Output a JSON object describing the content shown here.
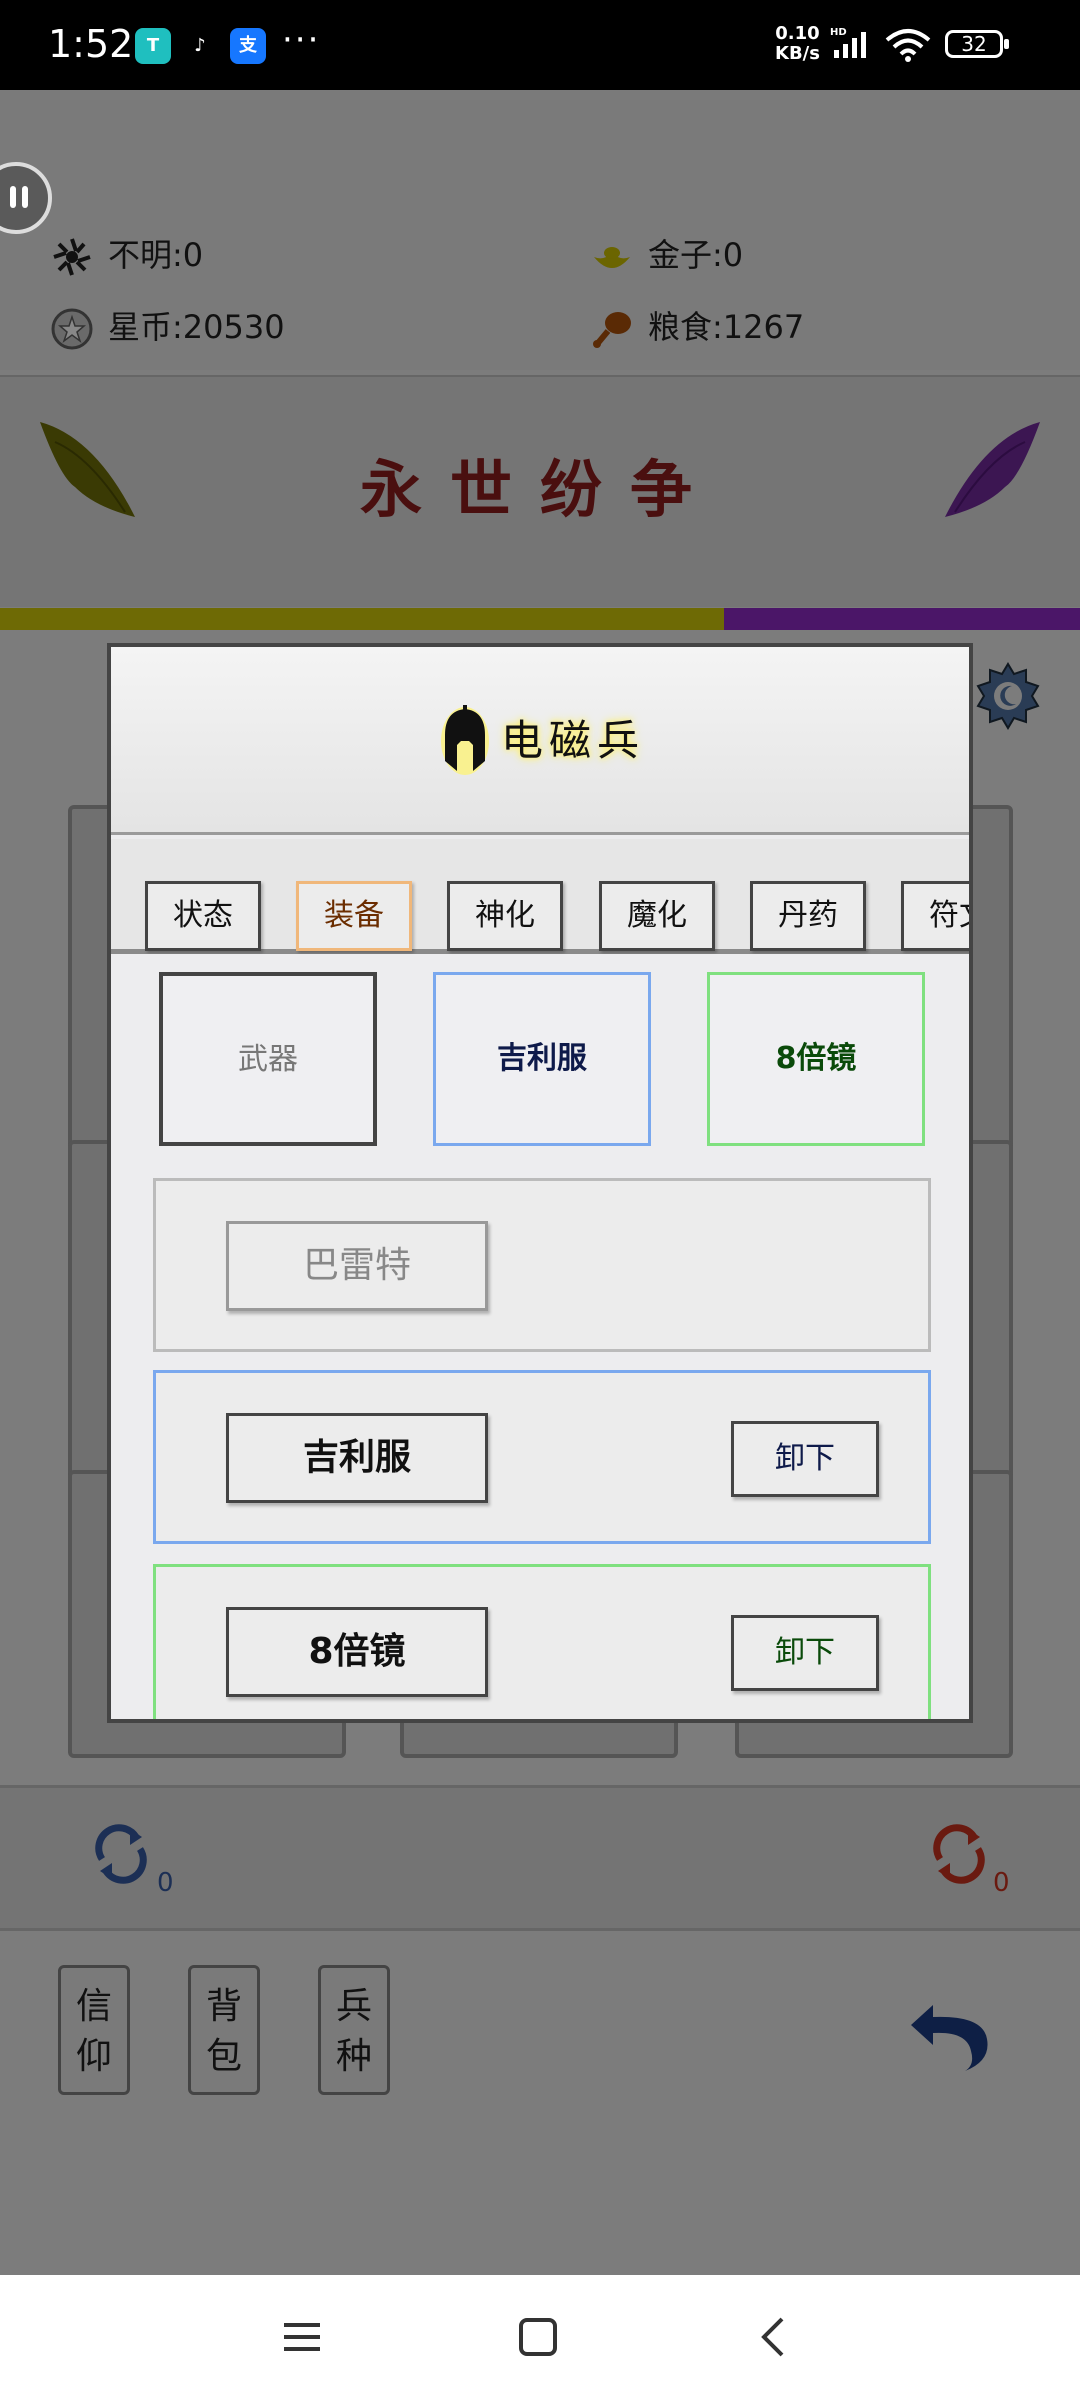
{
  "status_bar": {
    "time": "1:52",
    "app_icons": [
      "TapTap",
      "TikTok",
      "Alipay"
    ],
    "more": "···",
    "net_speed_value": "0.10",
    "net_speed_unit": "KB/s",
    "network": "HD",
    "battery": "32"
  },
  "resources": {
    "unknown_label": "不明:0",
    "gold_label": "金子:0",
    "starcoin_label": "星币:20530",
    "food_label": "粮食:1267"
  },
  "game": {
    "title": "永世纷争",
    "progress_fraction": 0.67,
    "refresh_left_count": "0",
    "refresh_right_count": "0",
    "side_buttons": [
      "信\n仰",
      "背\n包",
      "兵\n种"
    ]
  },
  "modal": {
    "unit_name": "电磁兵",
    "tabs": [
      "状态",
      "装备",
      "神化",
      "魔化",
      "丹药",
      "符文"
    ],
    "active_tab": "装备",
    "slots": {
      "weapon": "武器",
      "armor": "吉利服",
      "scope": "8倍镜"
    },
    "rows": [
      {
        "name": "巴雷特",
        "action": ""
      },
      {
        "name": "吉利服",
        "action": "卸下"
      },
      {
        "name": "8倍镜",
        "action": "卸下"
      }
    ]
  },
  "colors": {
    "accent_blue": "#7aa8ee",
    "accent_green": "#7fe07f",
    "active_tab_border": "#f0b77a",
    "title_color": "#4a0f0f"
  }
}
